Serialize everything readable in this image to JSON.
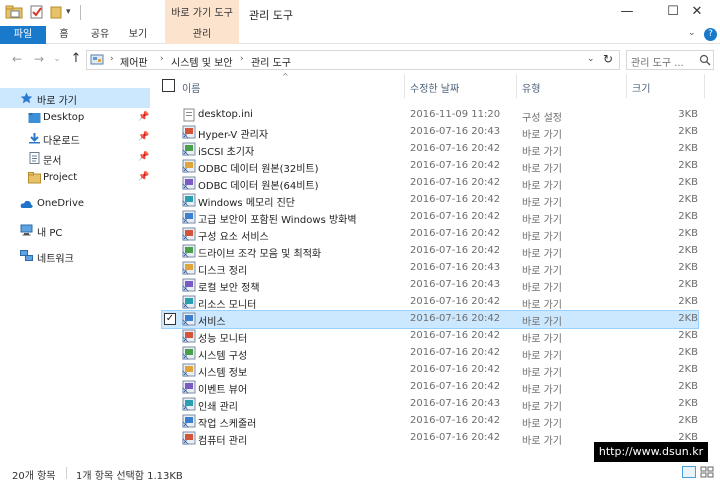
{
  "window": {
    "title": "관리 도구",
    "context_tab": "바로 가기 도구",
    "buttons": {
      "minimize": "—",
      "maximize": "☐",
      "close": "✕"
    }
  },
  "ribbon": {
    "tabs": [
      "파일",
      "홈",
      "공유",
      "보기",
      "관리"
    ],
    "active_tab": "파일",
    "accent_color": "#1979ca",
    "context_color": "#fbe3cd"
  },
  "address": {
    "crumbs": [
      "제어판",
      "시스템 및 보안",
      "관리 도구"
    ],
    "search_placeholder": "관리 도구 ..."
  },
  "nav": {
    "quick_access": "바로 가기",
    "pinned": [
      "Desktop",
      "다운로드",
      "문서",
      "Project"
    ],
    "onedrive": "OneDrive",
    "pc": "내 PC",
    "network": "네트워크"
  },
  "columns": {
    "name": "이름",
    "date": "수정한 날짜",
    "type": "유형",
    "size": "크기"
  },
  "files": [
    {
      "name": "desktop.ini",
      "date": "2016-11-09 11:20",
      "type": "구성 설정",
      "size": "3KB",
      "icon": "ini-file-icon"
    },
    {
      "name": "Hyper-V 관리자",
      "date": "2016-07-16 20:43",
      "type": "바로 가기",
      "size": "2KB",
      "icon": "hyperv-icon"
    },
    {
      "name": "iSCSI 초기자",
      "date": "2016-07-16 20:42",
      "type": "바로 가기",
      "size": "2KB",
      "icon": "iscsi-icon"
    },
    {
      "name": "ODBC 데이터 원본(32비트)",
      "date": "2016-07-16 20:42",
      "type": "바로 가기",
      "size": "2KB",
      "icon": "odbc-icon"
    },
    {
      "name": "ODBC 데이터 원본(64비트)",
      "date": "2016-07-16 20:42",
      "type": "바로 가기",
      "size": "2KB",
      "icon": "odbc-icon"
    },
    {
      "name": "Windows 메모리 진단",
      "date": "2016-07-16 20:42",
      "type": "바로 가기",
      "size": "2KB",
      "icon": "memory-diagnostic-icon"
    },
    {
      "name": "고급 보안이 포함된 Windows 방화벽",
      "date": "2016-07-16 20:42",
      "type": "바로 가기",
      "size": "2KB",
      "icon": "firewall-icon"
    },
    {
      "name": "구성 요소 서비스",
      "date": "2016-07-16 20:42",
      "type": "바로 가기",
      "size": "2KB",
      "icon": "component-services-icon"
    },
    {
      "name": "드라이브 조각 모음 및 최적화",
      "date": "2016-07-16 20:42",
      "type": "바로 가기",
      "size": "2KB",
      "icon": "defrag-icon"
    },
    {
      "name": "디스크 정리",
      "date": "2016-07-16 20:43",
      "type": "바로 가기",
      "size": "2KB",
      "icon": "disk-cleanup-icon"
    },
    {
      "name": "로컬 보안 정책",
      "date": "2016-07-16 20:43",
      "type": "바로 가기",
      "size": "2KB",
      "icon": "security-policy-icon"
    },
    {
      "name": "리소스 모니터",
      "date": "2016-07-16 20:42",
      "type": "바로 가기",
      "size": "2KB",
      "icon": "resource-monitor-icon"
    },
    {
      "name": "서비스",
      "date": "2016-07-16 20:42",
      "type": "바로 가기",
      "size": "2KB",
      "icon": "services-icon",
      "selected": true
    },
    {
      "name": "성능 모니터",
      "date": "2016-07-16 20:42",
      "type": "바로 가기",
      "size": "2KB",
      "icon": "performance-monitor-icon"
    },
    {
      "name": "시스템 구성",
      "date": "2016-07-16 20:42",
      "type": "바로 가기",
      "size": "2KB",
      "icon": "system-config-icon"
    },
    {
      "name": "시스템 정보",
      "date": "2016-07-16 20:42",
      "type": "바로 가기",
      "size": "2KB",
      "icon": "system-info-icon"
    },
    {
      "name": "이벤트 뷰어",
      "date": "2016-07-16 20:42",
      "type": "바로 가기",
      "size": "2KB",
      "icon": "event-viewer-icon"
    },
    {
      "name": "인쇄 관리",
      "date": "2016-07-16 20:43",
      "type": "바로 가기",
      "size": "2KB",
      "icon": "print-management-icon"
    },
    {
      "name": "작업 스케줄러",
      "date": "2016-07-16 20:42",
      "type": "바로 가기",
      "size": "2KB",
      "icon": "task-scheduler-icon"
    },
    {
      "name": "컴퓨터 관리",
      "date": "2016-07-16 20:42",
      "type": "바로 가기",
      "size": "2KB",
      "icon": "computer-management-icon"
    }
  ],
  "status": {
    "count": "20개 항목",
    "selection": "1개 항목 선택함 1.13KB"
  },
  "watermark": "http://www.dsun.kr"
}
